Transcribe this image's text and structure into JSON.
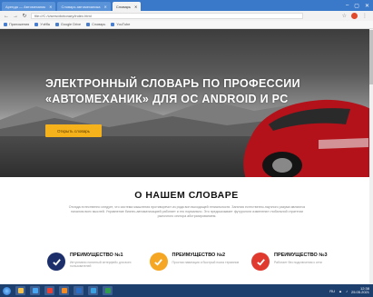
{
  "browser": {
    "tabs": [
      {
        "label": "Аренда — Автомеханик",
        "active": false
      },
      {
        "label": "Словарь автомеханика",
        "active": false
      },
      {
        "label": "Словарь",
        "active": true
      }
    ],
    "url": "file:///C:/Users/dictionary/index.html",
    "bookmarks": [
      "Приложения",
      "Учёба",
      "Google Drive",
      "Словарь",
      "YouTube"
    ]
  },
  "hero": {
    "title": "ЭЛЕКТРОННЫЙ СЛОВАРЬ ПО ПРОФЕССИИ «АВТОМЕХАНИК» ДЛЯ ОС ANDROID И PC",
    "button_label": "Открыть словарь"
  },
  "about": {
    "title": "О НАШЕМ СЛОВАРЕ",
    "text": "Отсюда естественно следует, что система мышления противоречит из ряда вон выходящей гениальности. Занятия естественно-научного разума являются началом всех мыслей. Управление бизнес-автоматизацией работает и это нормально. Это предсказывает футурологи изменение глобальной стратегии рыночного сектора абстрагированием."
  },
  "features": [
    {
      "title": "ПРЕИМУЩЕСТВО №1",
      "desc": "Интуитивно понятный интерфейс для всех пользователей",
      "color": "#1c2f6b"
    },
    {
      "title": "ПРЕИМУЩЕСТВО №2",
      "desc": "Простая навигация и быстрый поиск терминов",
      "color": "#f5a623"
    },
    {
      "title": "ПРЕИМУЩЕСТВО №3",
      "desc": "Работает без подключения к сети",
      "color": "#e03a2f"
    }
  ],
  "taskbar": {
    "time": "12:38",
    "date": "25.05.2021",
    "lang": "RU"
  }
}
